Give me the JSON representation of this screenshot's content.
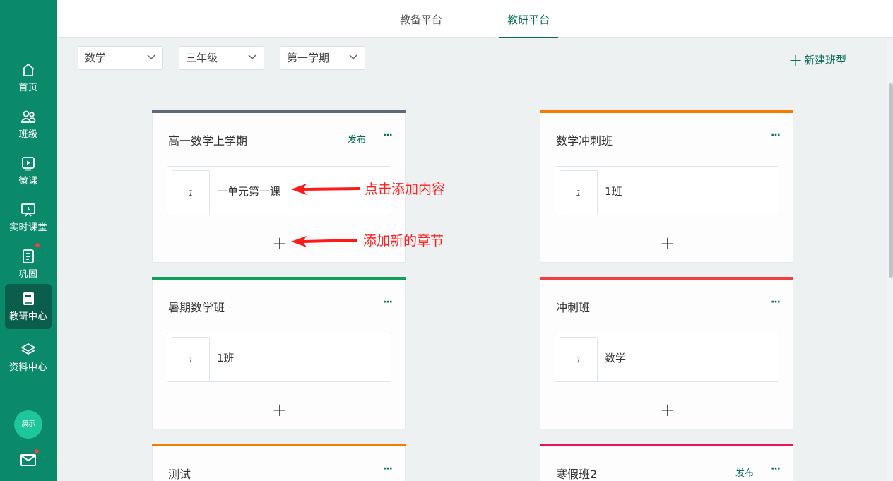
{
  "sidebar": {
    "items": [
      {
        "label": "首页",
        "icon": "home-icon",
        "active": false
      },
      {
        "label": "班级",
        "icon": "users-icon",
        "active": false
      },
      {
        "label": "微课",
        "icon": "video-icon",
        "active": false
      },
      {
        "label": "实时课堂",
        "icon": "classroom-icon",
        "active": false
      },
      {
        "label": "巩固",
        "icon": "notebook-icon",
        "active": false,
        "badge": true
      },
      {
        "label": "教研中心",
        "icon": "book-icon",
        "active": true
      },
      {
        "label": "资料中心",
        "icon": "layers-icon",
        "active": false
      }
    ],
    "avatar_text": "演示",
    "mail_icon": "mail-icon"
  },
  "topbar": {
    "tabs": [
      {
        "label": "教备平台",
        "active": false
      },
      {
        "label": "教研平台",
        "active": true
      }
    ]
  },
  "filters": {
    "subject": "数学",
    "grade": "三年级",
    "term": "第一学期"
  },
  "new_class_label": "新建班型",
  "cards": [
    {
      "title": "高一数学上学期",
      "color": "#5d6b78",
      "publish": "发布",
      "lesson_no": "1",
      "lesson": "一单元第一课"
    },
    {
      "title": "数学冲刺班",
      "color": "#f57c00",
      "publish": "",
      "lesson_no": "1",
      "lesson": "1班"
    },
    {
      "title": "暑期数学班",
      "color": "#0ca05a",
      "publish": "",
      "lesson_no": "1",
      "lesson": "1班"
    },
    {
      "title": "冲刺班",
      "color": "#ee4040",
      "publish": "",
      "lesson_no": "1",
      "lesson": "数学"
    },
    {
      "title": "测试",
      "color": "#f57c00",
      "publish": "",
      "lesson_no": "",
      "lesson": ""
    },
    {
      "title": "寒假班2",
      "color": "#e8145a",
      "publish": "发布",
      "lesson_no": "",
      "lesson": ""
    }
  ],
  "annotations": {
    "click_add_content": "点击添加内容",
    "add_new_chapter": "添加新的章节"
  },
  "more_glyph": "···",
  "add_glyph": "+"
}
